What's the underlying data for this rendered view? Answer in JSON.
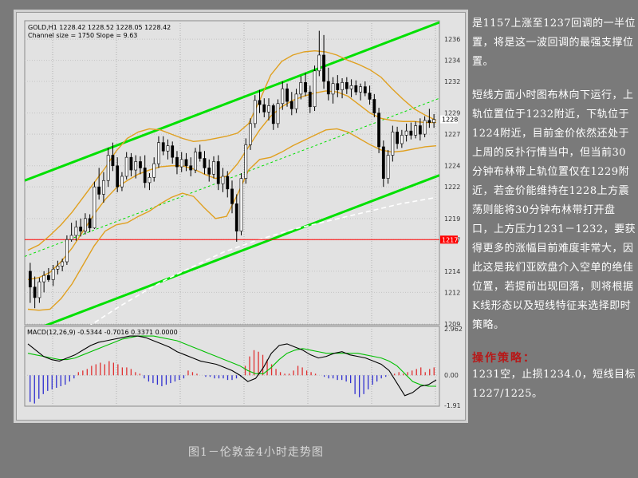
{
  "chart_header": {
    "symbol_line": "GOLD,H1  1228.42 1228.52 1228.05 1228.42",
    "channel_line": "Channel size = 1750 Slope = 9.63",
    "macd_label": "MACD(12,26,9) -0.5344 -0.7016 0.3371 0.0000"
  },
  "chart_data": [
    {
      "type": "candlestick",
      "title": "",
      "xlabel": "",
      "ylabel": "",
      "ylim": [
        1209,
        1237.6
      ],
      "y_ticks": [
        "1236",
        "1234",
        "1232",
        "1229",
        "1227",
        "1224",
        "1222",
        "1219",
        "1217",
        "1214",
        "1212",
        "1209"
      ],
      "current_price_label": "1228",
      "horizontal_line": {
        "value": 1217,
        "label": "1217",
        "color": "#ff0000"
      },
      "candles": [
        [
          1214,
          1214.8,
          1211,
          1212.5
        ],
        [
          1212.5,
          1213.5,
          1210.5,
          1211.5
        ],
        [
          1211.5,
          1213.4,
          1211,
          1213
        ],
        [
          1213,
          1214,
          1212,
          1213.6
        ],
        [
          1213.6,
          1214.3,
          1213,
          1213.2
        ],
        [
          1213.2,
          1214.6,
          1212.6,
          1214.2
        ],
        [
          1214.2,
          1215,
          1213.7,
          1214.5
        ],
        [
          1214.5,
          1215.2,
          1214,
          1214.9
        ],
        [
          1214.9,
          1217.4,
          1214.6,
          1217
        ],
        [
          1217,
          1218.6,
          1216.8,
          1217.4
        ],
        [
          1217.4,
          1218.8,
          1216.9,
          1218.2
        ],
        [
          1218.2,
          1219,
          1217.3,
          1217.8
        ],
        [
          1217.8,
          1219.5,
          1217.5,
          1219
        ],
        [
          1219,
          1219.4,
          1217.7,
          1218.1
        ],
        [
          1218.1,
          1222.5,
          1218,
          1222
        ],
        [
          1222,
          1223.8,
          1220.8,
          1221.3
        ],
        [
          1221.3,
          1223.4,
          1220.5,
          1222.6
        ],
        [
          1222.6,
          1225.7,
          1222,
          1225
        ],
        [
          1225,
          1226.2,
          1223.5,
          1224
        ],
        [
          1224,
          1224.8,
          1221.5,
          1222
        ],
        [
          1222,
          1223.4,
          1221.6,
          1223
        ],
        [
          1223,
          1225.3,
          1222.7,
          1224.8
        ],
        [
          1224.8,
          1225.2,
          1223,
          1223.6
        ],
        [
          1223.6,
          1225,
          1222.8,
          1224.4
        ],
        [
          1224.4,
          1224.9,
          1223.2,
          1223.8
        ],
        [
          1223.8,
          1225,
          1221.9,
          1222.4
        ],
        [
          1222.4,
          1223.3,
          1221.7,
          1222.9
        ],
        [
          1222.9,
          1224.8,
          1222.5,
          1224.2
        ],
        [
          1224.2,
          1226.8,
          1223.8,
          1226.2
        ],
        [
          1226.2,
          1226.8,
          1225,
          1225.4
        ],
        [
          1225.4,
          1226.5,
          1224.6,
          1225.9
        ],
        [
          1225.9,
          1226.3,
          1224.2,
          1224.8
        ],
        [
          1224.8,
          1225.4,
          1223.2,
          1223.9
        ],
        [
          1223.9,
          1225.3,
          1223.4,
          1224.6
        ],
        [
          1224.6,
          1225.2,
          1223.5,
          1224
        ],
        [
          1224,
          1224.8,
          1223,
          1223.6
        ],
        [
          1223.6,
          1225.7,
          1223.3,
          1225.3
        ],
        [
          1225.3,
          1226,
          1224.4,
          1224.7
        ],
        [
          1224.7,
          1225.4,
          1223.2,
          1223.8
        ],
        [
          1223.8,
          1224.6,
          1222.5,
          1223.2
        ],
        [
          1223.2,
          1224.9,
          1222.8,
          1224.4
        ],
        [
          1224.4,
          1225,
          1221.7,
          1222.3
        ],
        [
          1222.3,
          1223.8,
          1221.5,
          1223
        ],
        [
          1223,
          1223.5,
          1221,
          1221.8
        ],
        [
          1221.8,
          1222.6,
          1219.5,
          1220.4
        ],
        [
          1220.4,
          1221.3,
          1216.8,
          1217.8
        ],
        [
          1217.8,
          1223.3,
          1217.4,
          1222.8
        ],
        [
          1222.8,
          1226.6,
          1222.3,
          1226
        ],
        [
          1226,
          1228.5,
          1225.5,
          1228
        ],
        [
          1228,
          1230.7,
          1227.6,
          1230.2
        ],
        [
          1230.2,
          1231.2,
          1229,
          1229.8
        ],
        [
          1229.8,
          1230.4,
          1228.6,
          1229.1
        ],
        [
          1229.1,
          1230.4,
          1228.3,
          1229.7
        ],
        [
          1229.7,
          1229.9,
          1227.4,
          1228
        ],
        [
          1228,
          1230.3,
          1227.6,
          1229.9
        ],
        [
          1229.9,
          1232,
          1229.3,
          1231.3
        ],
        [
          1231.3,
          1231.8,
          1229.6,
          1230.1
        ],
        [
          1230.1,
          1231,
          1228.8,
          1229.4
        ],
        [
          1229.4,
          1231.3,
          1229,
          1230.8
        ],
        [
          1230.8,
          1232.5,
          1230.3,
          1231.9
        ],
        [
          1231.9,
          1232.8,
          1230.6,
          1231
        ],
        [
          1231,
          1231.6,
          1229,
          1229.6
        ],
        [
          1229.6,
          1233.5,
          1229.2,
          1233
        ],
        [
          1233,
          1236.8,
          1232.5,
          1234.5
        ],
        [
          1234.5,
          1236.4,
          1231.3,
          1232
        ],
        [
          1232,
          1233.3,
          1230.2,
          1230.8
        ],
        [
          1230.8,
          1232.4,
          1229.9,
          1231.8
        ],
        [
          1231.8,
          1232.6,
          1230.5,
          1231.2
        ],
        [
          1231.2,
          1232.3,
          1230.4,
          1231.9
        ],
        [
          1231.9,
          1232.4,
          1230.8,
          1231.3
        ],
        [
          1231.3,
          1232.2,
          1230.5,
          1231.6
        ],
        [
          1231.6,
          1232.1,
          1230.7,
          1231
        ],
        [
          1231,
          1231.8,
          1230.2,
          1231.5
        ],
        [
          1231.5,
          1232,
          1230.6,
          1230.9
        ],
        [
          1230.9,
          1231.6,
          1229.8,
          1230.3
        ],
        [
          1230.3,
          1230.8,
          1228.6,
          1229
        ],
        [
          1229,
          1229.5,
          1225.2,
          1225.8
        ],
        [
          1225.8,
          1226.4,
          1222,
          1222.8
        ],
        [
          1222.8,
          1225.5,
          1222.3,
          1225
        ],
        [
          1225,
          1227.8,
          1224.4,
          1227.2
        ],
        [
          1227.2,
          1227.7,
          1225.6,
          1226.1
        ],
        [
          1226.1,
          1227.4,
          1225.7,
          1226.9
        ],
        [
          1226.9,
          1228,
          1226.3,
          1227.3
        ],
        [
          1227.3,
          1228.1,
          1226.5,
          1226.9
        ],
        [
          1226.9,
          1228.2,
          1226.6,
          1227.8
        ],
        [
          1227.8,
          1228.5,
          1226.4,
          1227
        ],
        [
          1227,
          1228.7,
          1226.7,
          1228.3
        ],
        [
          1228.3,
          1229.4,
          1227.6,
          1228.1
        ],
        [
          1228.1,
          1228.9,
          1227.6,
          1228.4
        ]
      ],
      "bollinger": {
        "upper": [
          1216,
          1216.5,
          1217.4,
          1218.4,
          1219.6,
          1221,
          1222.4,
          1223.8,
          1225.4,
          1226.6,
          1227.2,
          1227.5,
          1227.4,
          1227,
          1226.6,
          1226.3,
          1226.4,
          1226.6,
          1226.8,
          1227.1,
          1228,
          1230.2,
          1232.6,
          1233.9,
          1234.5,
          1234.8,
          1234.9,
          1234.8,
          1234.5,
          1234,
          1233.6,
          1233.1,
          1232.4,
          1231.3,
          1230.3,
          1229.4,
          1228.8,
          1228.3
        ],
        "middle": [
          1213.2,
          1213.4,
          1213.9,
          1214.9,
          1216.2,
          1217.8,
          1219.4,
          1220.8,
          1221.9,
          1222.6,
          1223.2,
          1223.6,
          1223.9,
          1224,
          1224,
          1223.7,
          1223.2,
          1222.8,
          1223,
          1224.2,
          1225.8,
          1227.4,
          1228.7,
          1229.6,
          1230.2,
          1230.6,
          1230.9,
          1231.1,
          1231,
          1230.6,
          1229.8,
          1229,
          1228.5,
          1228.3,
          1228.2,
          1228.2,
          1228.1,
          1228.1
        ],
        "lower": [
          1210.4,
          1210.3,
          1210.4,
          1211.4,
          1212.8,
          1214.6,
          1216.4,
          1217.8,
          1218.4,
          1218.6,
          1219.2,
          1219.7,
          1220.4,
          1221,
          1221.4,
          1221.1,
          1220,
          1219,
          1219.2,
          1221.3,
          1223.6,
          1224.6,
          1224.8,
          1225.3,
          1225.9,
          1226.4,
          1226.9,
          1227.4,
          1227.5,
          1227.2,
          1226.6,
          1226,
          1225.5,
          1225.3,
          1225.4,
          1225.6,
          1225.8,
          1225.9
        ]
      },
      "moving_average_white": [
        1205,
        1206,
        1207.2,
        1208.3,
        1209.4,
        1210.5,
        1211.5,
        1212.5,
        1213.4,
        1214.2,
        1215,
        1215.8,
        1216.4,
        1217,
        1217.5,
        1218,
        1218.4,
        1218.8,
        1219.2,
        1219.6,
        1220,
        1220.4,
        1220.7,
        1221
      ],
      "channel": {
        "color": "#00e000",
        "upper_start": 1222.6,
        "upper_end": 1237.6,
        "lower_start": 1208.1,
        "lower_end": 1223.1,
        "mid_start": 1215.4,
        "mid_end": 1230.4
      }
    },
    {
      "type": "bar",
      "title": "MACD(12,26,9) -0.5344 -0.7016 0.3371 0.0000",
      "ylim": [
        -1.92,
        2.962
      ],
      "y_ticks": [
        "2.962",
        "0.00",
        "-1.91"
      ],
      "histogram": [
        -1.7,
        -1.8,
        -1.5,
        -1.2,
        -1.0,
        -0.9,
        -0.8,
        -0.7,
        -0.6,
        -0.4,
        -0.2,
        0.2,
        0.3,
        0.4,
        0.6,
        0.7,
        0.8,
        0.7,
        0.9,
        0.8,
        0.7,
        0.5,
        0.5,
        0.4,
        0.2,
        0.1,
        -0.2,
        -0.4,
        -0.5,
        -0.6,
        -0.7,
        -0.6,
        -0.5,
        -0.4,
        -0.3,
        -0.2,
        0.3,
        0.2,
        0.1,
        0.0,
        -0.1,
        -0.1,
        -0.2,
        -0.2,
        -0.2,
        -0.3,
        -0.3,
        -0.2,
        -0.1,
        0.6,
        1.2,
        1.6,
        1.5,
        1.3,
        1.0,
        0.7,
        0.4,
        0.2,
        0.1,
        0.1,
        0.3,
        0.6,
        0.5,
        0.3,
        0.2,
        0.1,
        0.0,
        -0.1,
        -0.2,
        -0.2,
        -0.3,
        -0.3,
        -0.4,
        -0.5,
        -1.2,
        -1.4,
        -1.2,
        -0.9,
        -0.6,
        -0.4,
        -0.2,
        -0.1,
        0.0,
        0.1,
        0.2,
        0.1,
        0.2,
        0.3,
        0.4,
        0.5,
        0.2,
        0.4,
        0.5
      ],
      "macd_line": [
        2.0,
        1.6,
        1.2,
        1.0,
        0.9,
        1.1,
        1.3,
        1.6,
        1.9,
        2.1,
        2.2,
        2.3,
        2.4,
        2.5,
        2.5,
        2.4,
        2.2,
        2.0,
        1.8,
        1.5,
        1.3,
        1.1,
        0.9,
        0.8,
        0.7,
        0.5,
        0.3,
        0.0,
        -0.4,
        -0.2,
        0.5,
        1.4,
        1.9,
        2.0,
        1.8,
        1.6,
        1.3,
        1.1,
        1.2,
        1.4,
        1.5,
        1.3,
        1.2,
        1.1,
        0.9,
        0.7,
        0.3,
        -0.5,
        -1.3,
        -1.1,
        -0.7,
        -0.6,
        -0.3
      ],
      "signal_line": [
        1.4,
        1.3,
        1.2,
        1.1,
        1.0,
        1.0,
        1.1,
        1.3,
        1.5,
        1.7,
        1.9,
        2.1,
        2.3,
        2.4,
        2.5,
        2.5,
        2.5,
        2.4,
        2.3,
        2.2,
        2.0,
        1.8,
        1.6,
        1.4,
        1.2,
        1.0,
        0.8,
        0.6,
        0.3,
        0.1,
        0.1,
        0.5,
        1.0,
        1.4,
        1.6,
        1.7,
        1.6,
        1.5,
        1.4,
        1.4,
        1.4,
        1.4,
        1.4,
        1.3,
        1.2,
        1.1,
        0.9,
        0.6,
        0.1,
        -0.4,
        -0.6,
        -0.7,
        -0.7
      ]
    }
  ],
  "caption": "图1－伦敦金4小时走势图",
  "right_panel": {
    "paragraphs": [
      "是1157上涨至1237回调的一半位置，将是这一波回调的最强支撑位置。",
      "短线方面小时图布林向下运行，上轨位置位于1232附近，下轨位于1224附近，目前金价依然还处于上周的反扑行情当中，但当前30分钟布林带上轨位置仅在1229附近，若金价能维持在1228上方震荡则能将30分钟布林带打开盘口，上方压力1231－1232，要获得更多的涨幅目前难度非常大，因此这是我们亚欧盘介入空单的绝佳位置，若提前出现回落，则将根据K线形态以及短线特征来选择即时策略。"
    ],
    "strategy_title": "操作策略：",
    "strategy_text": "1231空，止损1234.0，短线目标1227/1225。"
  },
  "colors": {
    "background": "#7a7a7a",
    "chart_bg": "#e2e2e2",
    "candle": "#000000",
    "channel": "#00e000",
    "bollinger": "#e0a020",
    "macd_up": "#e03030",
    "macd_down": "#3030d0",
    "macd_line": "#000000",
    "signal_line": "#00c000",
    "strategy_title": "#b71818",
    "price_line": "#ff0000"
  }
}
